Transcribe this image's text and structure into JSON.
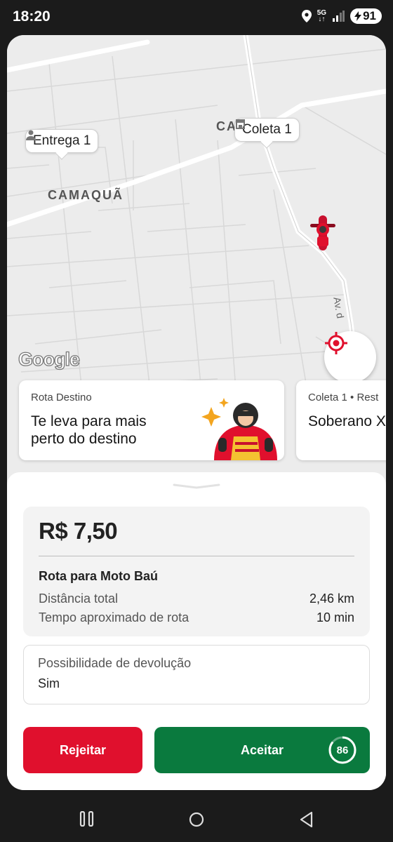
{
  "status_bar": {
    "time": "18:20",
    "network": "5G",
    "battery": "91"
  },
  "map": {
    "neighborhood_label": "CAMAQUÃ",
    "partial_label": "CA",
    "street_label": "Av. d",
    "pins": {
      "delivery": "Entrega 1",
      "pickup": "Coleta 1"
    },
    "google_logo": "Google"
  },
  "cards": [
    {
      "eyebrow": "Rota Destino",
      "title": "Te leva para mais perto do destino"
    },
    {
      "eyebrow": "Coleta 1 • Rest",
      "title": "Soberano X"
    }
  ],
  "offer": {
    "price": "R$ 7,50",
    "route_title": "Rota para Moto Baú",
    "distance_label": "Distância total",
    "distance_value": "2,46 km",
    "time_label": "Tempo aproximado de rota",
    "time_value": "10 min",
    "return_label": "Possibilidade de devolução",
    "return_value": "Sim"
  },
  "actions": {
    "reject": "Rejeitar",
    "accept": "Aceitar",
    "countdown": "86"
  },
  "colors": {
    "brand_red": "#e0102d",
    "accept_green": "#0a7a3e"
  }
}
